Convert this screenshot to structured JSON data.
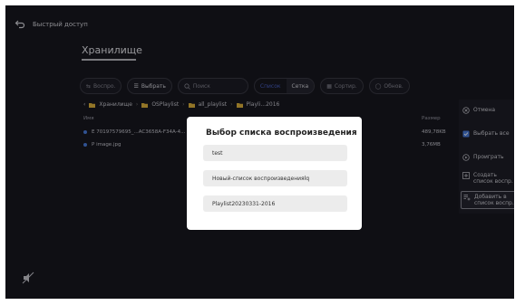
{
  "topbar": {
    "title": "Быстрый доступ"
  },
  "storage_tab": "Хранилище",
  "toolbar": {
    "play_label": "Воспро.",
    "select_label": "Выбрать",
    "search_placeholder": "Поиск",
    "view_list": "Список",
    "view_grid": "Сетка",
    "sort_label": "Сортир.",
    "refresh_label": "Обнов."
  },
  "breadcrumb": [
    "Хранилище",
    "OSPlaylist",
    "all_playlist",
    "Playli...2016"
  ],
  "list": {
    "col_name": "Имя",
    "col_size": "Размер",
    "rows": [
      {
        "name": "E 70197579695_...AC3658A-F34A-4...",
        "size": "489,78KB"
      },
      {
        "name": "P image.jpg",
        "size": "3,76MB"
      }
    ]
  },
  "right_panel": {
    "cancel": "Отмена",
    "select_all": "Выбрать все",
    "play": "Проиграть",
    "create_line1": "Создать",
    "create_line2": "список воспр.",
    "add_line1": "Добавить в",
    "add_line2": "список воспр."
  },
  "dialog": {
    "title": "Выбор списка воспроизведения",
    "items": [
      "test",
      "Новый-список воспроизведенияlq",
      "Playlist20230331-2016"
    ]
  },
  "colors": {
    "accent": "#4a62c8",
    "background": "#17171f",
    "dialog_bg": "#ffffff"
  }
}
